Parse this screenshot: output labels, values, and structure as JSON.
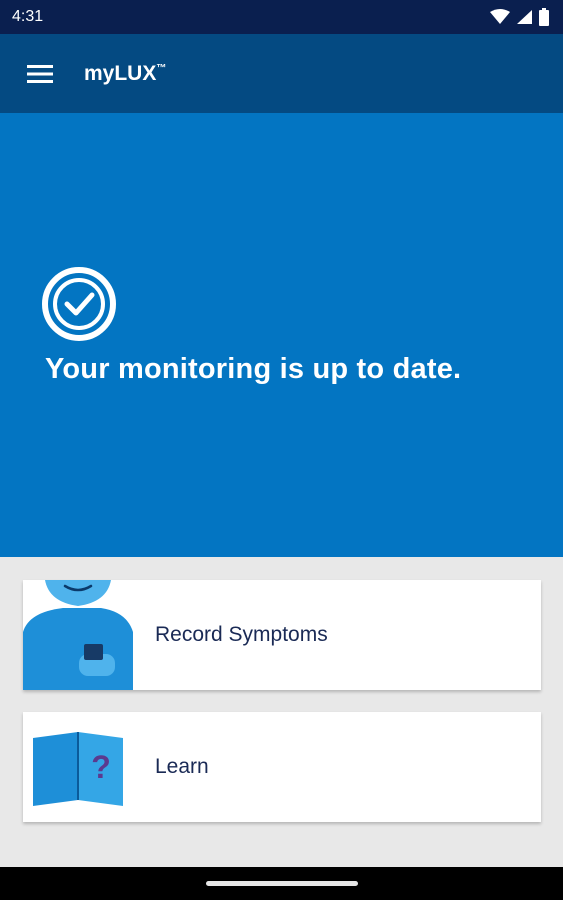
{
  "status_bar": {
    "time": "4:31",
    "icons": [
      "wifi-icon",
      "cell-signal-icon",
      "battery-icon"
    ]
  },
  "app_bar": {
    "menu_icon": "hamburger-menu-icon",
    "title": "myLUX",
    "trademark": "™"
  },
  "hero": {
    "icon": "check-circle-icon",
    "message": "Your monitoring is up to date."
  },
  "cards": [
    {
      "label": "Record Symptoms",
      "illustration": "person-with-phone-icon"
    },
    {
      "label": "Learn",
      "illustration": "book-question-icon"
    }
  ],
  "colors": {
    "status_bar": "#0a1f4f",
    "app_bar": "#044a82",
    "hero": "#0375c2",
    "background": "#e8e8e8",
    "card_text": "#1a2a55"
  }
}
